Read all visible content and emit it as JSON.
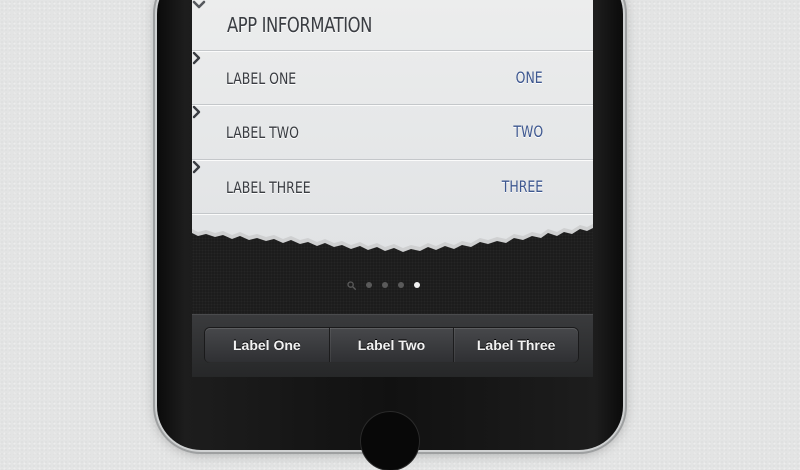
{
  "header": {
    "title": "APP INFORMATION",
    "icon": "chevron-down-icon"
  },
  "rows": [
    {
      "label": "LABEL ONE",
      "value": "ONE"
    },
    {
      "label": "LABEL TWO",
      "value": "TWO"
    },
    {
      "label": "LABEL THREE",
      "value": "THREE"
    }
  ],
  "page_indicator": {
    "pages": 5,
    "active_page": 5,
    "first_is_search": true
  },
  "tabs": [
    "Label One",
    "Label Two",
    "Label Three"
  ],
  "colors": {
    "value_text": "#3e5890",
    "label_text": "#3a3d42",
    "paper": "#e6e7e9",
    "screen_bg": "#1c1c1c"
  }
}
